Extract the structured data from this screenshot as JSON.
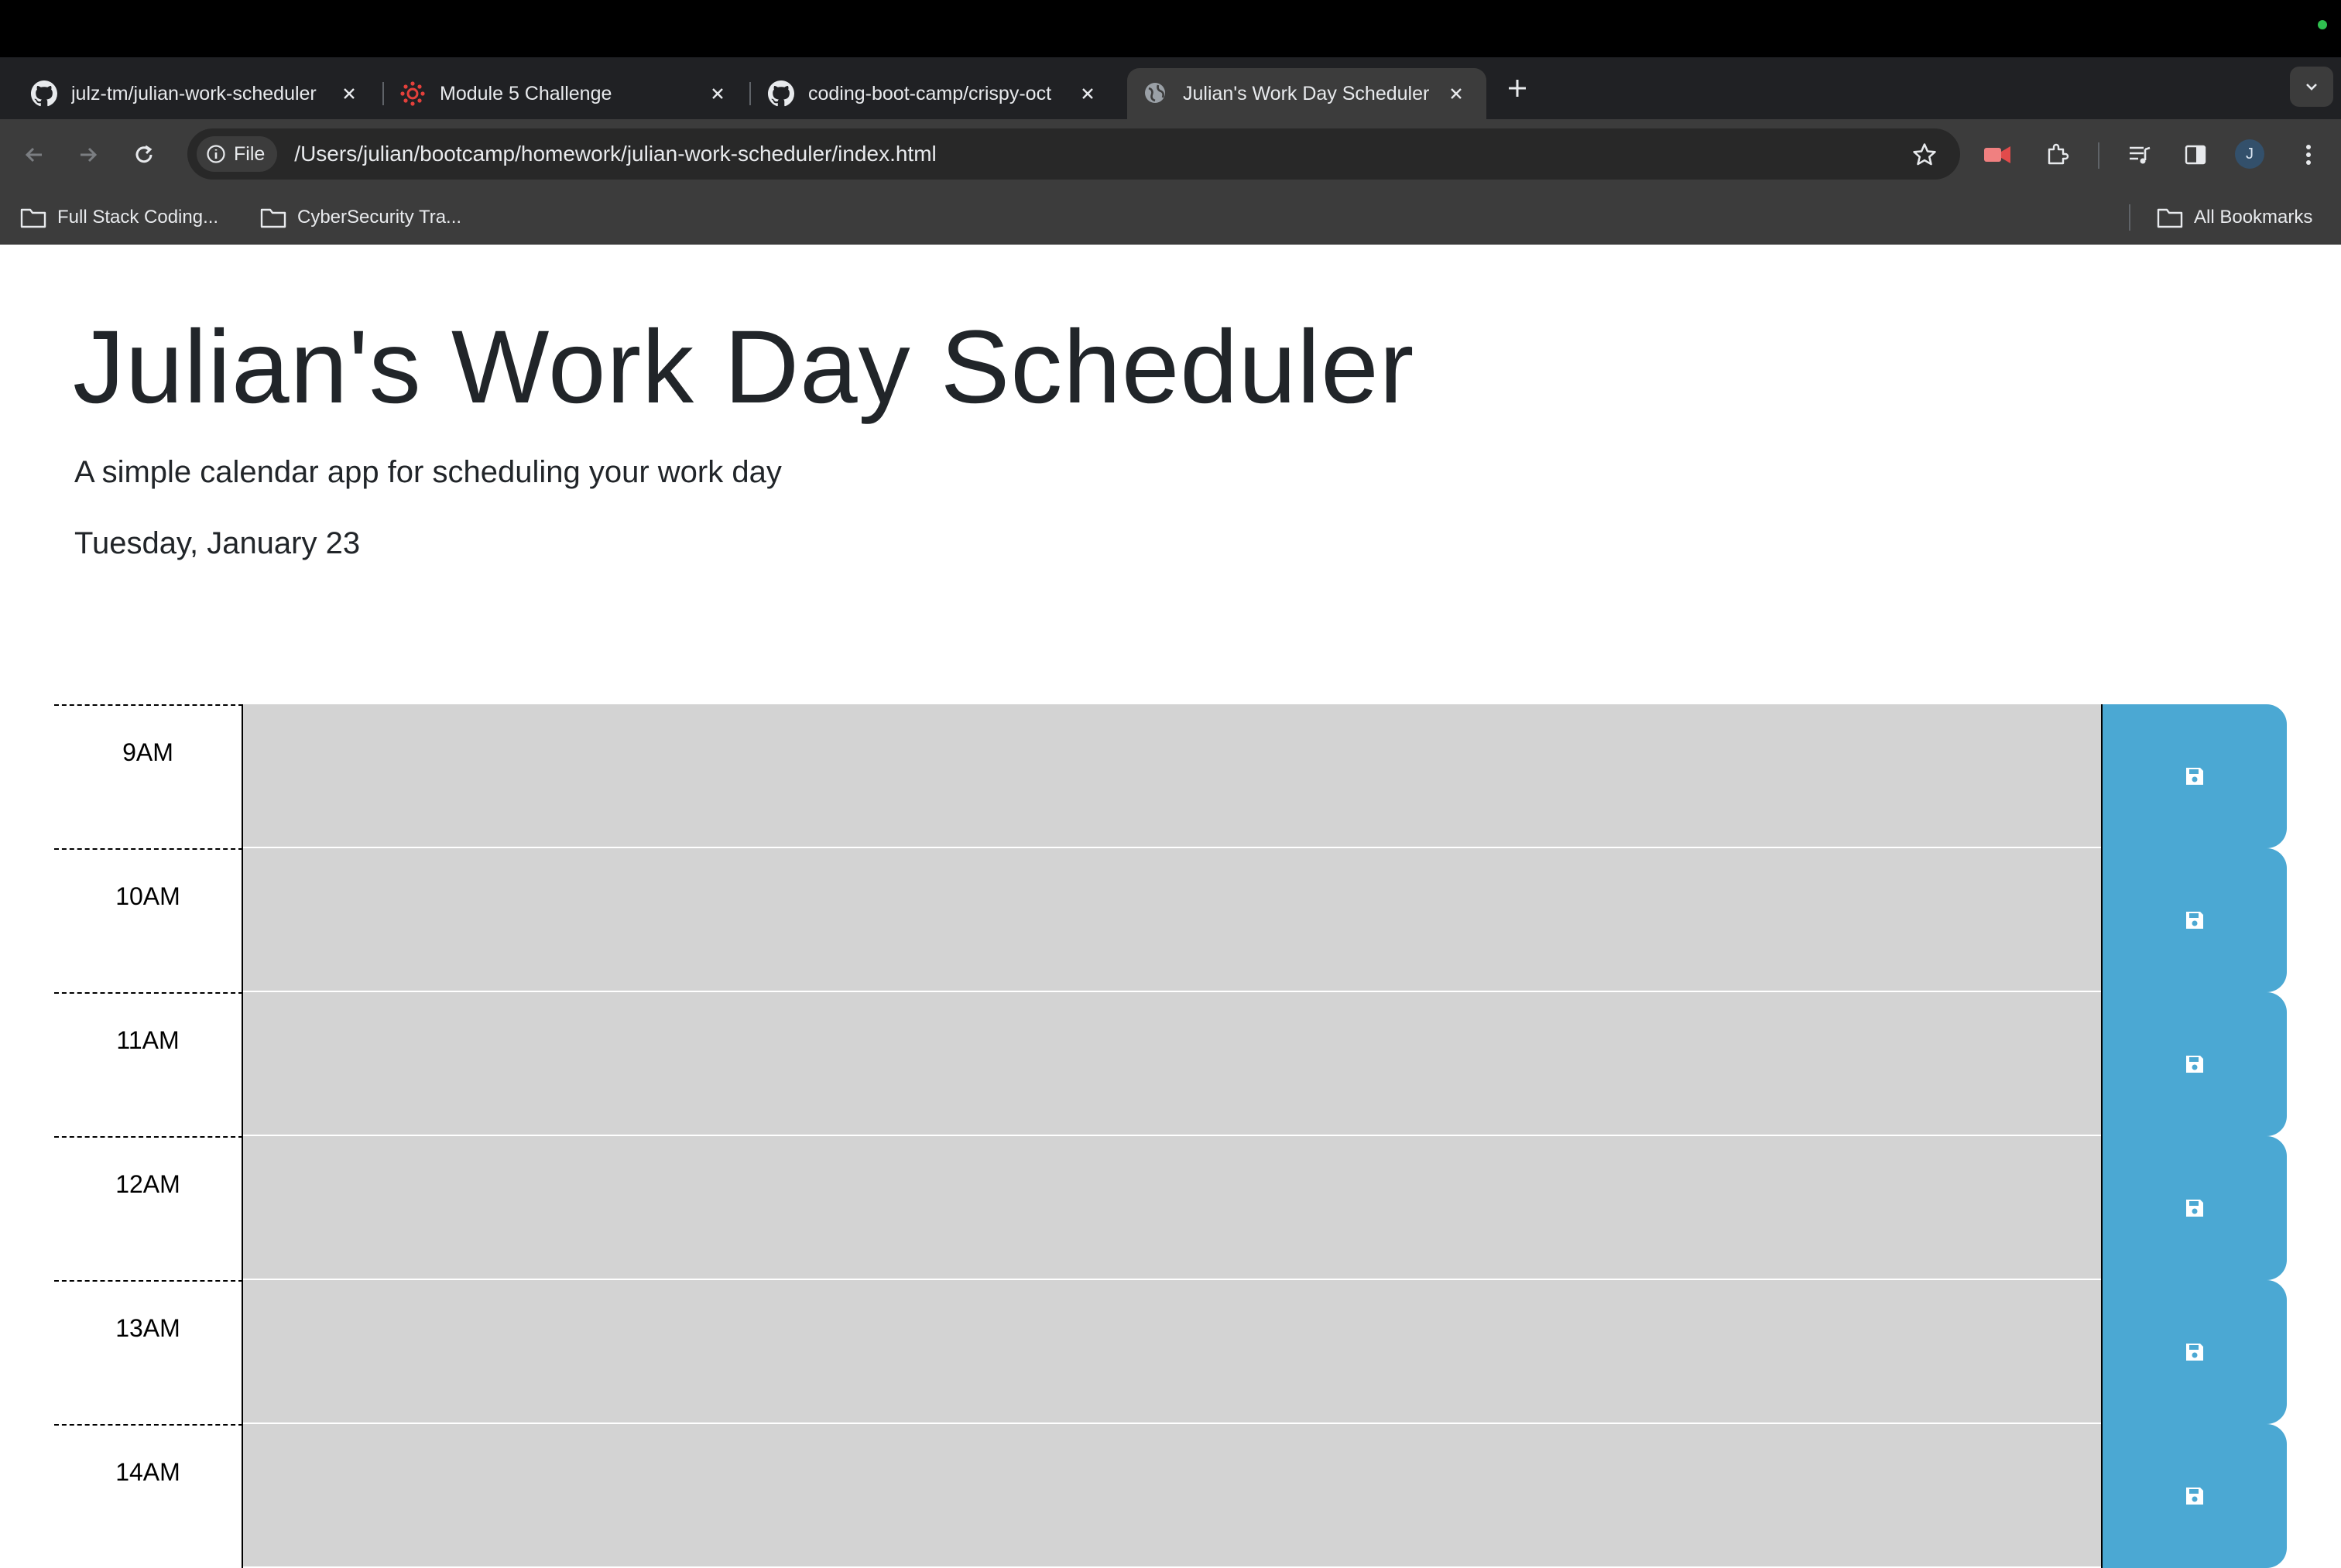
{
  "tabs": [
    {
      "title": "julz-tm/julian-work-scheduler",
      "favicon": "github-icon"
    },
    {
      "title": "Module 5 Challenge",
      "favicon": "canvas-icon"
    },
    {
      "title": "coding-boot-camp/crispy-oct",
      "favicon": "github-icon"
    },
    {
      "title": "Julian's Work Day Scheduler",
      "favicon": "globe-icon"
    }
  ],
  "address_bar": {
    "scheme_chip": "File",
    "url": "/Users/julian/bootcamp/homework/julian-work-scheduler/index.html"
  },
  "profile_initial": "J",
  "bookmarks": {
    "items": [
      "Full Stack Coding...",
      "CyberSecurity Tra..."
    ],
    "all_bookmarks": "All Bookmarks"
  },
  "header": {
    "title": "Julian's Work Day Scheduler",
    "lead": "A simple calendar app for scheduling your work day",
    "current_day": "Tuesday, January 23"
  },
  "time_blocks": [
    {
      "hour": "9AM",
      "text": ""
    },
    {
      "hour": "10AM",
      "text": ""
    },
    {
      "hour": "11AM",
      "text": ""
    },
    {
      "hour": "12AM",
      "text": ""
    },
    {
      "hour": "13AM",
      "text": ""
    },
    {
      "hour": "14AM",
      "text": ""
    }
  ],
  "colors": {
    "past_block": "#d3d3d3",
    "save_button": "#4ba8d3"
  }
}
